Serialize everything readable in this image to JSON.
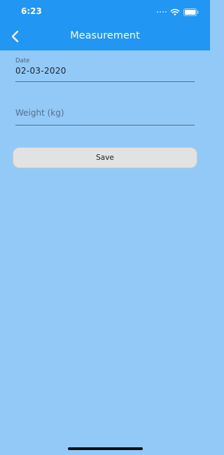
{
  "status_bar": {
    "time": "6:23",
    "icons": [
      "signal-dots-icon",
      "wifi-icon",
      "battery-icon"
    ]
  },
  "nav": {
    "title": "Measurement",
    "back_icon": "chevron-left-icon"
  },
  "form": {
    "date_label": "Date",
    "date_value": "02-03-2020",
    "weight_placeholder": "Weight (kg)",
    "weight_value": ""
  },
  "actions": {
    "save_label": "Save"
  },
  "colors": {
    "header": "#2196f3",
    "background": "#92c9f7",
    "button": "#e2e2e2"
  }
}
